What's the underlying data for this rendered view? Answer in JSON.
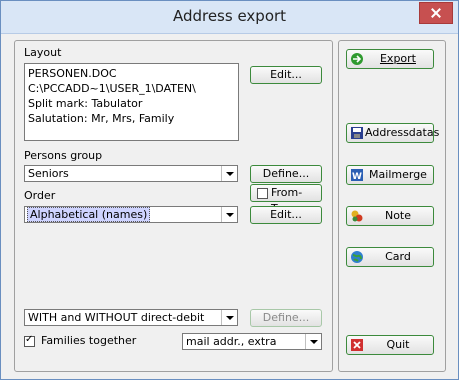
{
  "window": {
    "title": "Address export"
  },
  "layout": {
    "label": "Layout",
    "lines": [
      "PERSONEN.DOC",
      "C:\\PCCADD~1\\USER_1\\DATEN\\",
      "Split mark: Tabulator",
      "Salutation: Mr, Mrs, Family"
    ],
    "edit_label": "Edit..."
  },
  "persons_group": {
    "label": "Persons group",
    "value": "Seniors",
    "define_label": "Define...",
    "from_to_label": "From-To..."
  },
  "order": {
    "label": "Order",
    "value": "Alphabetical (names)",
    "edit_label": "Edit..."
  },
  "direct_debit": {
    "value": "WITH and WITHOUT direct-debit",
    "define_label": "Define..."
  },
  "families": {
    "label": "Families together",
    "checked": true,
    "mail_value": "mail addr., extra"
  },
  "actions": {
    "export": "Export",
    "addressdatas": "Addressdatas",
    "mailmerge": "Mailmerge",
    "note": "Note",
    "card": "Card",
    "quit": "Quit"
  }
}
